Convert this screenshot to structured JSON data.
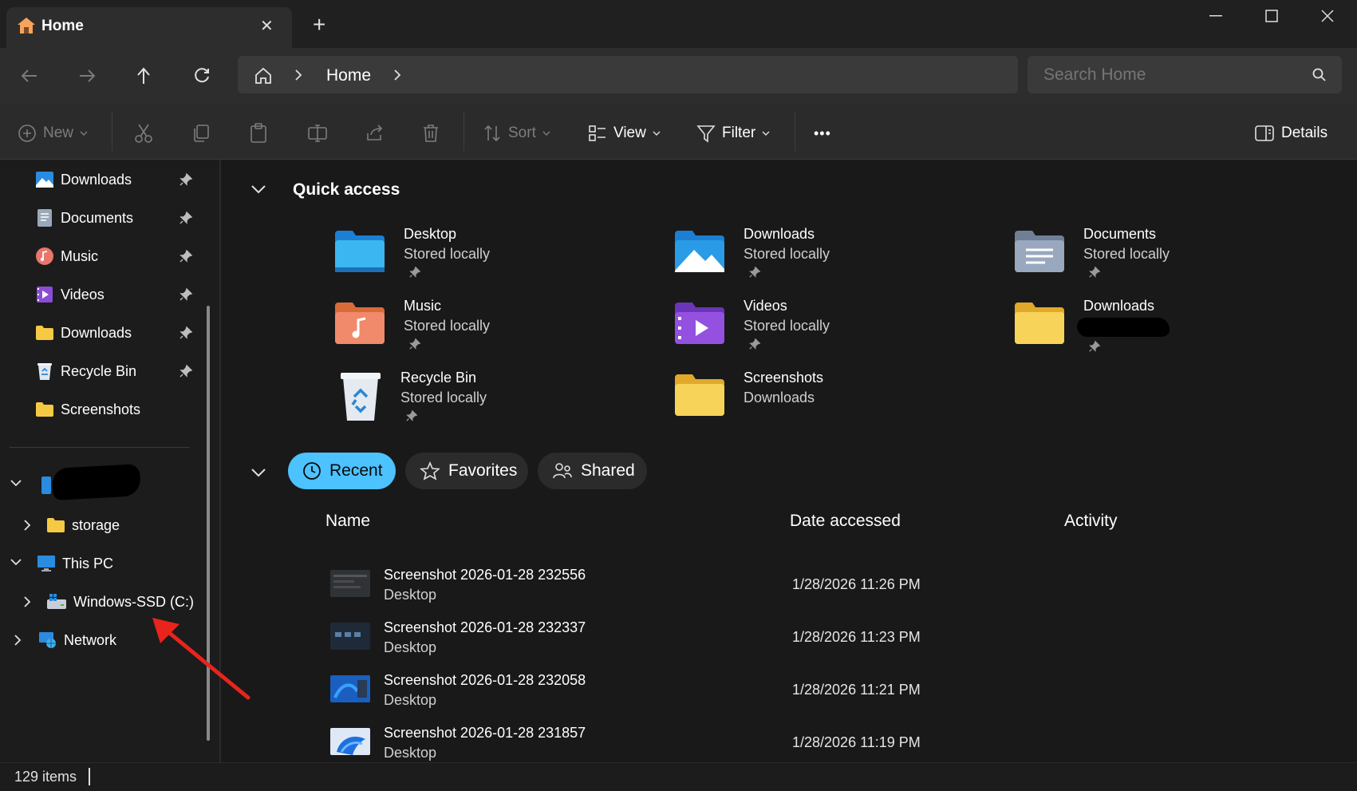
{
  "window": {
    "tab_title": "Home",
    "new_tab": "+",
    "close_tab": "✕"
  },
  "address": {
    "crumb_home": "Home"
  },
  "search": {
    "placeholder": "Search Home"
  },
  "toolbar": {
    "new_label": "New",
    "sort_label": "Sort",
    "view_label": "View",
    "filter_label": "Filter",
    "more_label": "•••",
    "details_label": "Details"
  },
  "sidebar": {
    "pinned": [
      {
        "label": "Downloads",
        "icon": "downloads-blue-icon"
      },
      {
        "label": "Documents",
        "icon": "documents-icon"
      },
      {
        "label": "Music",
        "icon": "music-icon"
      },
      {
        "label": "Videos",
        "icon": "videos-icon"
      },
      {
        "label": "Downloads",
        "icon": "folder-icon"
      },
      {
        "label": "Recycle Bin",
        "icon": "recycle-bin-icon"
      }
    ],
    "screenshots_label": "Screenshots",
    "storage_label": "storage",
    "this_pc_label": "This PC",
    "drive_label": "Windows-SSD (C:)",
    "network_label": "Network"
  },
  "quick_access": {
    "title": "Quick access",
    "items": [
      {
        "name": "Desktop",
        "sub": "Stored locally",
        "icon": "desktop-folder-icon"
      },
      {
        "name": "Downloads",
        "sub": "Stored locally",
        "icon": "downloads-folder-icon"
      },
      {
        "name": "Documents",
        "sub": "Stored locally",
        "icon": "documents-folder-icon"
      },
      {
        "name": "Music",
        "sub": "Stored locally",
        "icon": "music-folder-icon"
      },
      {
        "name": "Videos",
        "sub": "Stored locally",
        "icon": "videos-folder-icon"
      },
      {
        "name": "Downloads",
        "sub": "",
        "icon": "yellow-folder-icon"
      },
      {
        "name": "Recycle Bin",
        "sub": "Stored locally",
        "icon": "recycle-bin-icon"
      },
      {
        "name": "Screenshots",
        "sub": "Downloads",
        "icon": "yellow-folder-icon"
      }
    ]
  },
  "recent": {
    "tabs": {
      "recent": "Recent",
      "favorites": "Favorites",
      "shared": "Shared"
    },
    "columns": {
      "name": "Name",
      "date": "Date accessed",
      "activity": "Activity"
    },
    "rows": [
      {
        "name": "Screenshot 2026-01-28 232556",
        "location": "Desktop",
        "date": "1/28/2026 11:26 PM"
      },
      {
        "name": "Screenshot 2026-01-28 232337",
        "location": "Desktop",
        "date": "1/28/2026 11:23 PM"
      },
      {
        "name": "Screenshot 2026-01-28 232058",
        "location": "Desktop",
        "date": "1/28/2026 11:21 PM"
      },
      {
        "name": "Screenshot 2026-01-28 231857",
        "location": "Desktop",
        "date": "1/28/2026 11:19 PM"
      }
    ]
  },
  "status": {
    "items_count": "129 items"
  },
  "colors": {
    "accent": "#4cc2ff",
    "annotation_arrow": "#e8241d"
  }
}
